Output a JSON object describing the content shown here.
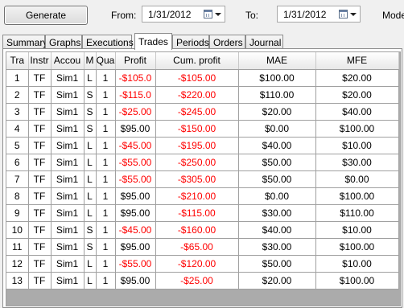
{
  "toolbar": {
    "generate_label": "Generate",
    "from_label": "From:",
    "from_date": "1/31/2012",
    "to_label": "To:",
    "to_date": "1/31/2012",
    "mode_label": "Mode"
  },
  "tabs": [
    {
      "label": "Summary",
      "active": false
    },
    {
      "label": "Graphs",
      "active": false
    },
    {
      "label": "Executions",
      "active": false
    },
    {
      "label": "Trades",
      "active": true
    },
    {
      "label": "Periods",
      "active": false
    },
    {
      "label": "Orders",
      "active": false
    },
    {
      "label": "Journal",
      "active": false
    }
  ],
  "table": {
    "columns": [
      "Tra",
      "Instr",
      "Accou",
      "M",
      "Qua",
      "Profit",
      "Cum. profit",
      "MAE",
      "MFE"
    ],
    "negative_color": "#ff0000",
    "rows": [
      [
        "1",
        "TF",
        "Sim1",
        "L",
        "1",
        "-$105.0",
        "-$105.00",
        "$100.00",
        "$20.00"
      ],
      [
        "2",
        "TF",
        "Sim1",
        "S",
        "1",
        "-$115.0",
        "-$220.00",
        "$110.00",
        "$20.00"
      ],
      [
        "3",
        "TF",
        "Sim1",
        "S",
        "1",
        "-$25.00",
        "-$245.00",
        "$20.00",
        "$40.00"
      ],
      [
        "4",
        "TF",
        "Sim1",
        "S",
        "1",
        "$95.00",
        "-$150.00",
        "$0.00",
        "$100.00"
      ],
      [
        "5",
        "TF",
        "Sim1",
        "L",
        "1",
        "-$45.00",
        "-$195.00",
        "$40.00",
        "$10.00"
      ],
      [
        "6",
        "TF",
        "Sim1",
        "L",
        "1",
        "-$55.00",
        "-$250.00",
        "$50.00",
        "$30.00"
      ],
      [
        "7",
        "TF",
        "Sim1",
        "L",
        "1",
        "-$55.00",
        "-$305.00",
        "$50.00",
        "$0.00"
      ],
      [
        "8",
        "TF",
        "Sim1",
        "L",
        "1",
        "$95.00",
        "-$210.00",
        "$0.00",
        "$100.00"
      ],
      [
        "9",
        "TF",
        "Sim1",
        "L",
        "1",
        "$95.00",
        "-$115.00",
        "$30.00",
        "$110.00"
      ],
      [
        "10",
        "TF",
        "Sim1",
        "S",
        "1",
        "-$45.00",
        "-$160.00",
        "$40.00",
        "$10.00"
      ],
      [
        "11",
        "TF",
        "Sim1",
        "S",
        "1",
        "$95.00",
        "-$65.00",
        "$30.00",
        "$100.00"
      ],
      [
        "12",
        "TF",
        "Sim1",
        "L",
        "1",
        "-$55.00",
        "-$120.00",
        "$50.00",
        "$10.00"
      ],
      [
        "13",
        "TF",
        "Sim1",
        "L",
        "1",
        "$95.00",
        "-$25.00",
        "$20.00",
        "$100.00"
      ]
    ]
  }
}
